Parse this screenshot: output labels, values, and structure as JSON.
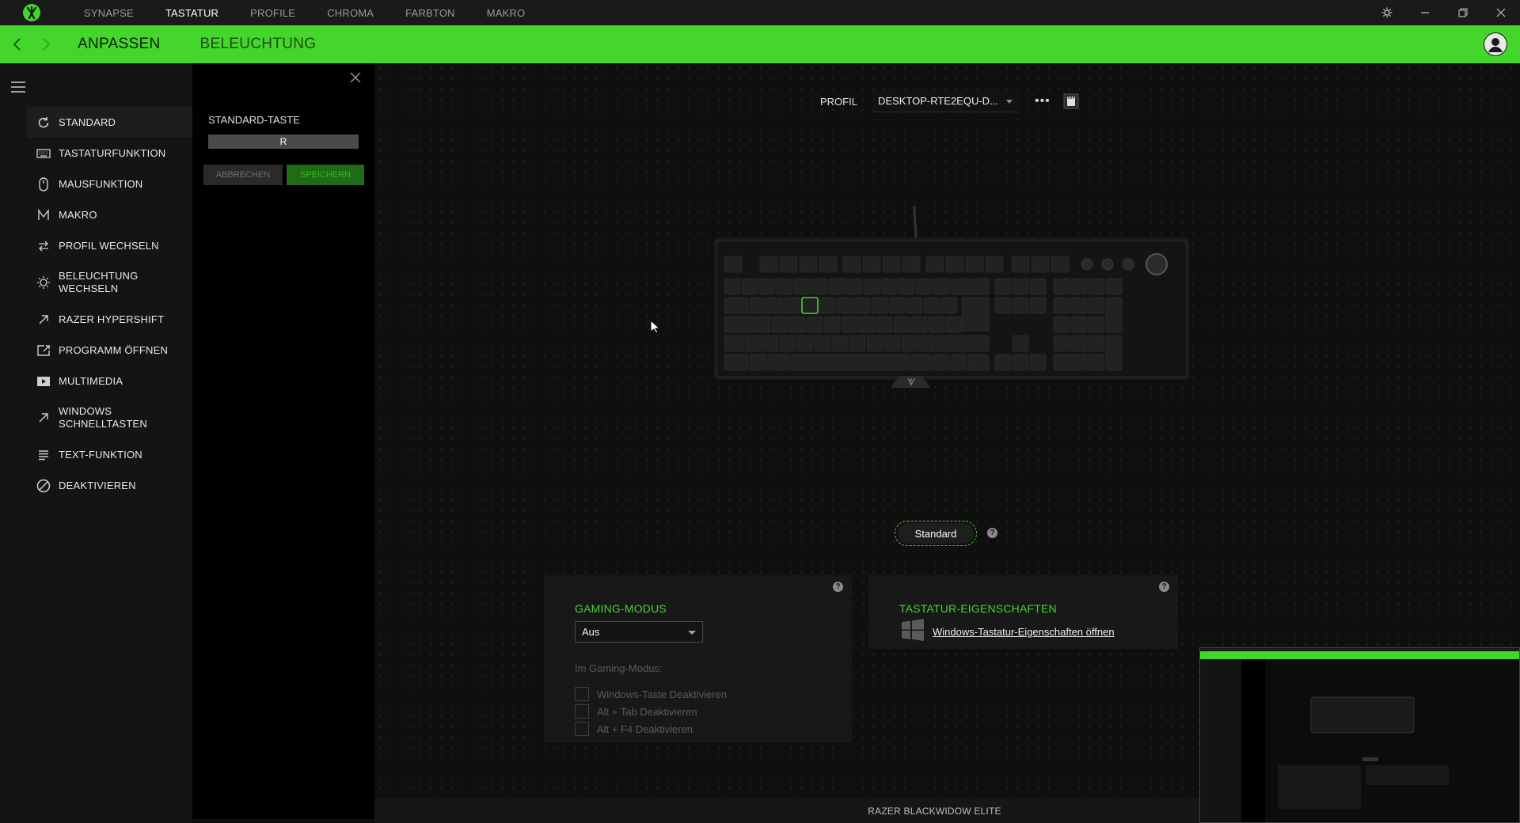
{
  "topnav": {
    "tabs": [
      "SYNAPSE",
      "TASTATUR",
      "PROFILE",
      "CHROMA",
      "FARBTON",
      "MAKRO"
    ],
    "active": "TASTATUR"
  },
  "header": {
    "subtabs": [
      "ANPASSEN",
      "BELEUCHTUNG"
    ],
    "active": "ANPASSEN"
  },
  "sidebar": {
    "items": [
      {
        "label": "STANDARD",
        "icon": "refresh-icon"
      },
      {
        "label": "TASTATURFUNKTION",
        "icon": "keyboard-icon"
      },
      {
        "label": "MAUSFUNKTION",
        "icon": "mouse-icon"
      },
      {
        "label": "MAKRO",
        "icon": "macro-icon"
      },
      {
        "label": "PROFIL WECHSELN",
        "icon": "swap-icon"
      },
      {
        "label": "BELEUCHTUNG WECHSELN",
        "icon": "sun-icon"
      },
      {
        "label": "RAZER HYPERSHIFT",
        "icon": "arrow-up-right-icon"
      },
      {
        "label": "PROGRAMM ÖFFNEN",
        "icon": "launch-icon"
      },
      {
        "label": "MULTIMEDIA",
        "icon": "play-icon"
      },
      {
        "label": "WINDOWS SCHNELLTASTEN",
        "icon": "arrow-up-right-icon"
      },
      {
        "label": "TEXT-FUNKTION",
        "icon": "text-icon"
      },
      {
        "label": "DEAKTIVIEREN",
        "icon": "block-icon"
      }
    ],
    "active_index": 0
  },
  "panel": {
    "title": "STANDARD-TASTE",
    "key_value": "R",
    "cancel_label": "ABBRECHEN",
    "save_label": "SPEICHERN"
  },
  "profile": {
    "label": "PROFIL",
    "selected": "DESKTOP-RTE2EQU-D...",
    "more_icon": "more-dots-icon",
    "onboard_icon": "onboard-memory-icon"
  },
  "standard_button": "Standard",
  "gaming": {
    "title": "GAMING-MODUS",
    "selected": "Aus",
    "subtitle": "Im Gaming-Modus:",
    "options": [
      "Windows-Taste Deaktivieren",
      "Alt + Tab Deaktivieren",
      "Alt + F4 Deaktivieren"
    ]
  },
  "props": {
    "title": "TASTATUR-EIGENSCHAFTEN",
    "link": "Windows-Tastatur-Eigenschaften öffnen"
  },
  "footer": {
    "device": "RAZER BLACKWIDOW ELITE"
  },
  "colors": {
    "accent": "#44d62c",
    "background": "#101010",
    "panel": "#181818"
  }
}
